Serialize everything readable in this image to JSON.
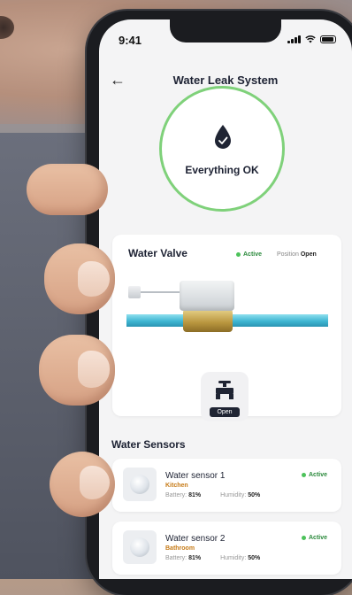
{
  "status_bar": {
    "time": "9:41"
  },
  "header": {
    "title": "Water Leak System",
    "back_icon": "arrow-left-icon"
  },
  "system_status": {
    "text": "Everything OK",
    "icon": "water-drop-check-icon",
    "ring_color": "#7fd17a"
  },
  "valve": {
    "title": "Water Valve",
    "state_label": "Active",
    "position_label": "Position",
    "position_value": "Open",
    "button_label": "Open",
    "button_icon": "faucet-icon"
  },
  "sensors": {
    "section_title": "Water Sensors",
    "items": [
      {
        "name": "Water sensor 1",
        "room": "Kitchen",
        "status": "Active",
        "battery_label": "Battery:",
        "battery": "81%",
        "humidity_label": "Humidity:",
        "humidity": "50%"
      },
      {
        "name": "Water sensor 2",
        "room": "Bathroom",
        "status": "Active",
        "battery_label": "Battery:",
        "battery": "81%",
        "humidity_label": "Humidity:",
        "humidity": "50%"
      }
    ]
  },
  "colors": {
    "accent_green": "#4cc25a",
    "dark": "#1f2433",
    "room_orange": "#c67a16"
  }
}
